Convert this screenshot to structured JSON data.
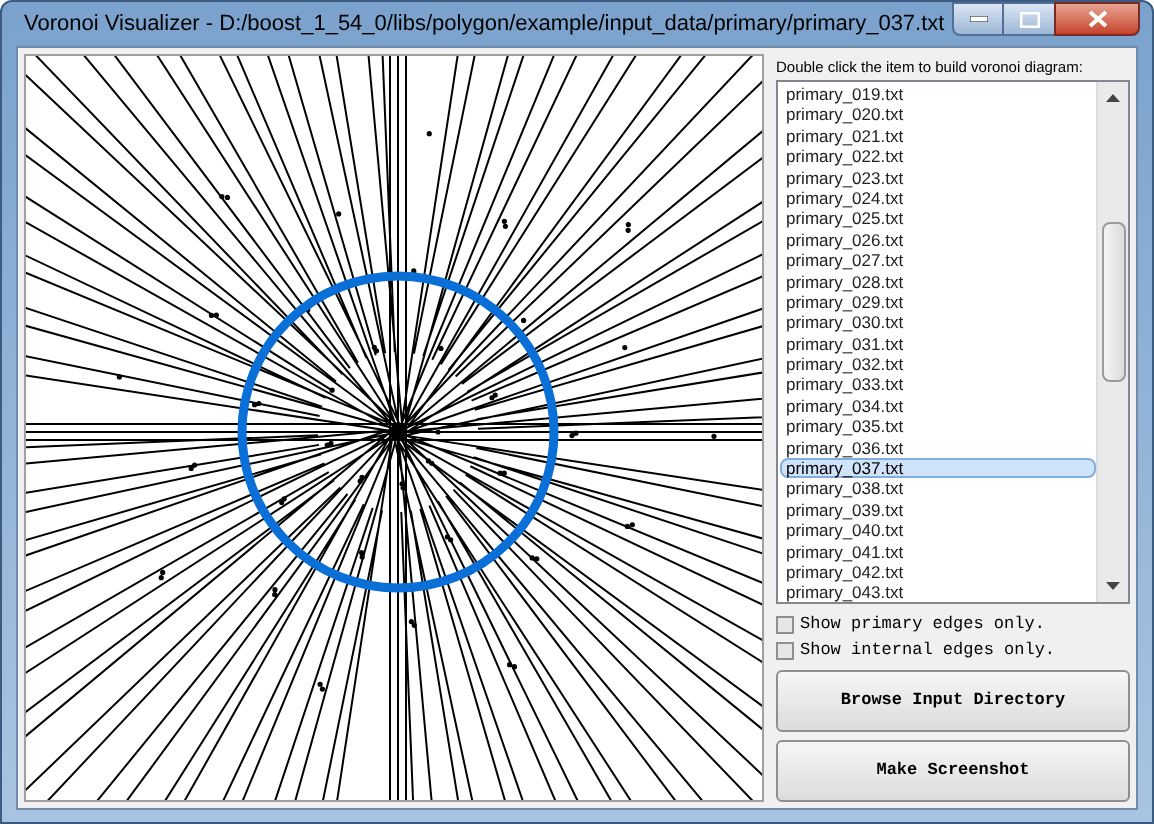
{
  "window": {
    "title": "Voronoi Visualizer - D:/boost_1_54_0/libs/polygon/example/input_data/primary/primary_037.txt"
  },
  "file_list": {
    "label": "Double click the item to build voronoi diagram:",
    "items": [
      {
        "text": "primary_019.txt",
        "selected": false
      },
      {
        "text": "primary_020.txt",
        "selected": false
      },
      {
        "text": "primary_021.txt",
        "selected": false
      },
      {
        "text": "primary_022.txt",
        "selected": false
      },
      {
        "text": "primary_023.txt",
        "selected": false
      },
      {
        "text": "primary_024.txt",
        "selected": false
      },
      {
        "text": "primary_025.txt",
        "selected": false
      },
      {
        "text": "primary_026.txt",
        "selected": false
      },
      {
        "text": "primary_027.txt",
        "selected": false
      },
      {
        "text": "primary_028.txt",
        "selected": false
      },
      {
        "text": "primary_029.txt",
        "selected": false
      },
      {
        "text": "primary_030.txt",
        "selected": false
      },
      {
        "text": "primary_031.txt",
        "selected": false
      },
      {
        "text": "primary_032.txt",
        "selected": false
      },
      {
        "text": "primary_033.txt",
        "selected": false
      },
      {
        "text": "primary_034.txt",
        "selected": false
      },
      {
        "text": "primary_035.txt",
        "selected": false
      },
      {
        "text": "primary_036.txt",
        "selected": false
      },
      {
        "text": "primary_037.txt",
        "selected": true
      },
      {
        "text": "primary_038.txt",
        "selected": false
      },
      {
        "text": "primary_039.txt",
        "selected": false
      },
      {
        "text": "primary_040.txt",
        "selected": false
      },
      {
        "text": "primary_041.txt",
        "selected": false
      },
      {
        "text": "primary_042.txt",
        "selected": false
      },
      {
        "text": "primary_043.txt",
        "selected": false
      }
    ]
  },
  "options": [
    {
      "label": "Show primary edges only.",
      "checked": false
    },
    {
      "label": "Show internal edges only.",
      "checked": false
    }
  ],
  "buttons": [
    "Browse Input Directory",
    "Make Screenshot"
  ]
}
